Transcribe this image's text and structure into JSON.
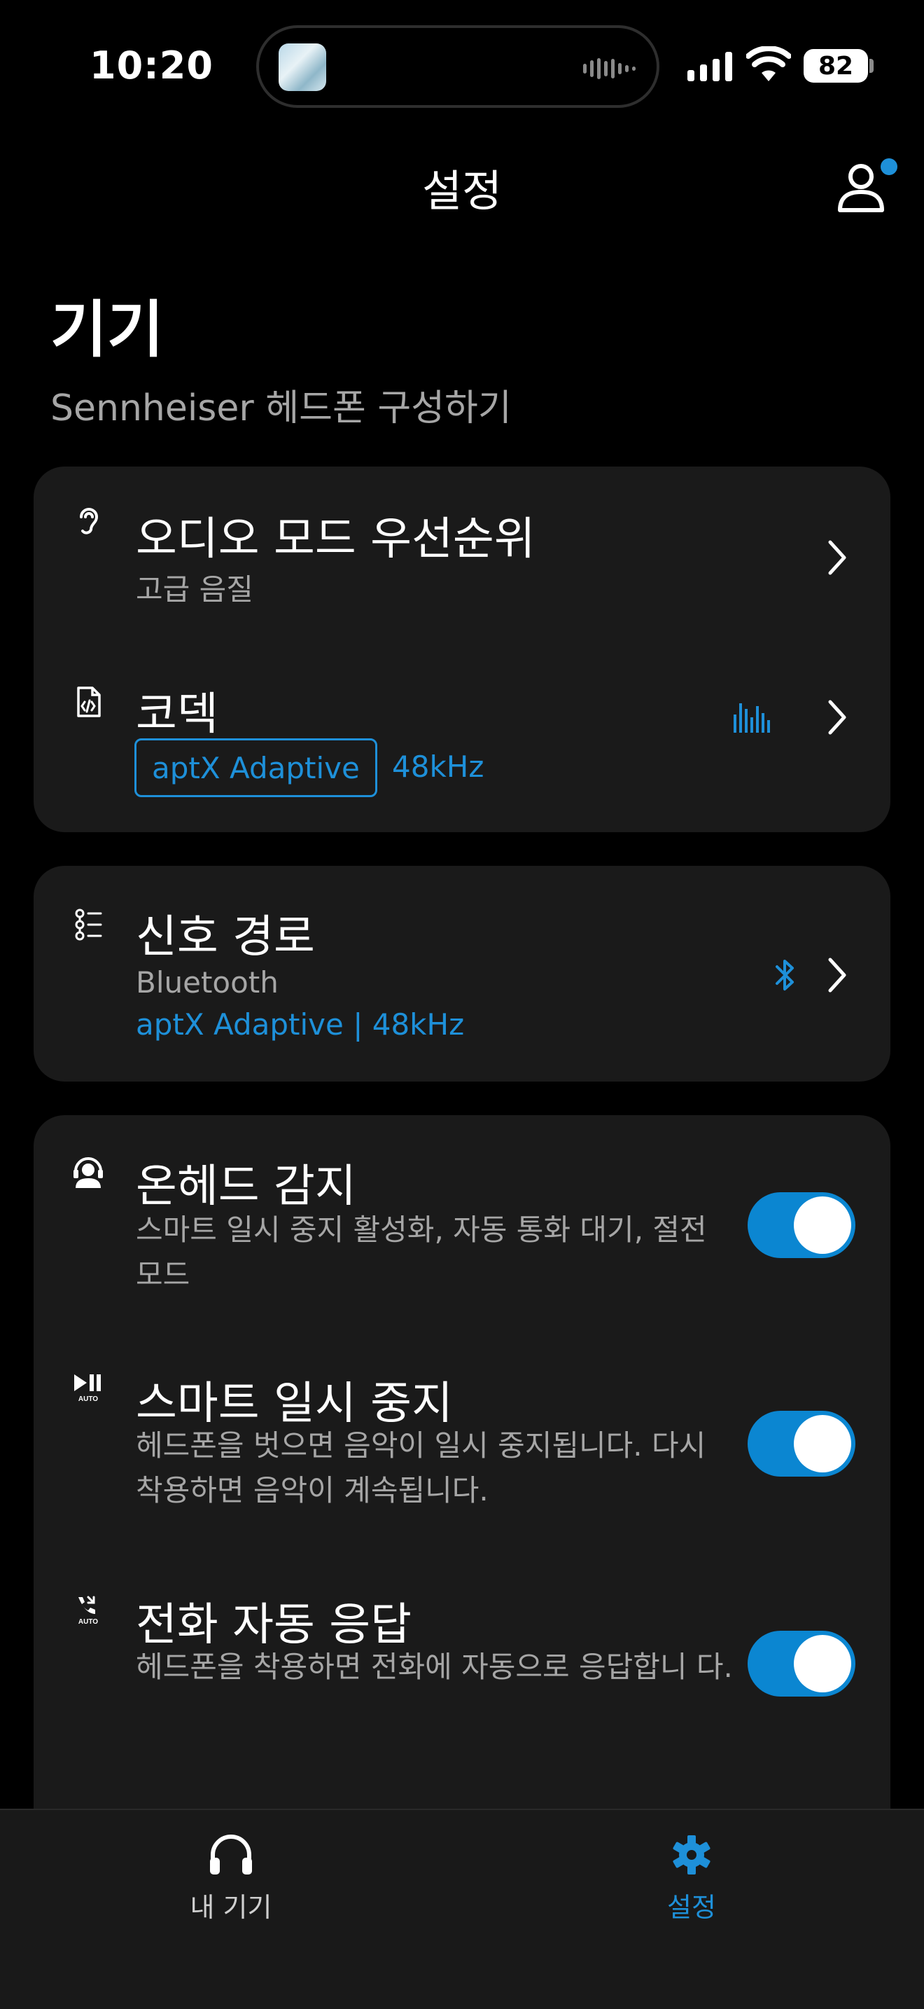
{
  "status_bar": {
    "time": "10:20",
    "battery": "82"
  },
  "header": {
    "title": "설정",
    "profile_icon": "person-icon",
    "notification_color": "#1e90d9"
  },
  "page": {
    "title": "기기",
    "subtitle": "Sennheiser 헤드폰 구성하기"
  },
  "audio_card": {
    "audio_mode": {
      "icon": "ear-icon",
      "title": "오디오 모드 우선순위",
      "value": "고급 음질"
    },
    "codec": {
      "icon": "code-file-icon",
      "title": "코덱",
      "codec_name": "aptX Adaptive",
      "sample_rate": "48kHz",
      "status_icon": "audio-bars-icon"
    }
  },
  "signal_card": {
    "icon": "signal-path-icon",
    "title": "신호 경로",
    "connection": "Bluetooth",
    "detail": "aptX Adaptive | 48kHz",
    "status_icon": "bluetooth-icon"
  },
  "toggles_card": {
    "items": [
      {
        "icon": "on-head-detection-icon",
        "title": "온헤드 감지",
        "description": "스마트 일시 중지 활성화, 자동 통화 대기, 절전 모드",
        "enabled": true
      },
      {
        "icon": "smart-pause-icon",
        "title": "스마트 일시 중지",
        "description": "헤드폰을 벗으면 음악이 일시 중지됩니다. 다시 착용하면 음악이 계속됩니다.",
        "enabled": true
      },
      {
        "icon": "auto-answer-icon",
        "title": "전화 자동 응답",
        "description": "헤드폰을 착용하면 전화에 자동으로 응답합니 다.",
        "enabled": true
      }
    ]
  },
  "tabbar": {
    "tabs": [
      {
        "label": "내 기기",
        "icon": "headphones-icon",
        "active": false
      },
      {
        "label": "설정",
        "icon": "gear-icon",
        "active": true
      }
    ],
    "active_color": "#1e90d9",
    "inactive_color": "#cfcfcf"
  }
}
